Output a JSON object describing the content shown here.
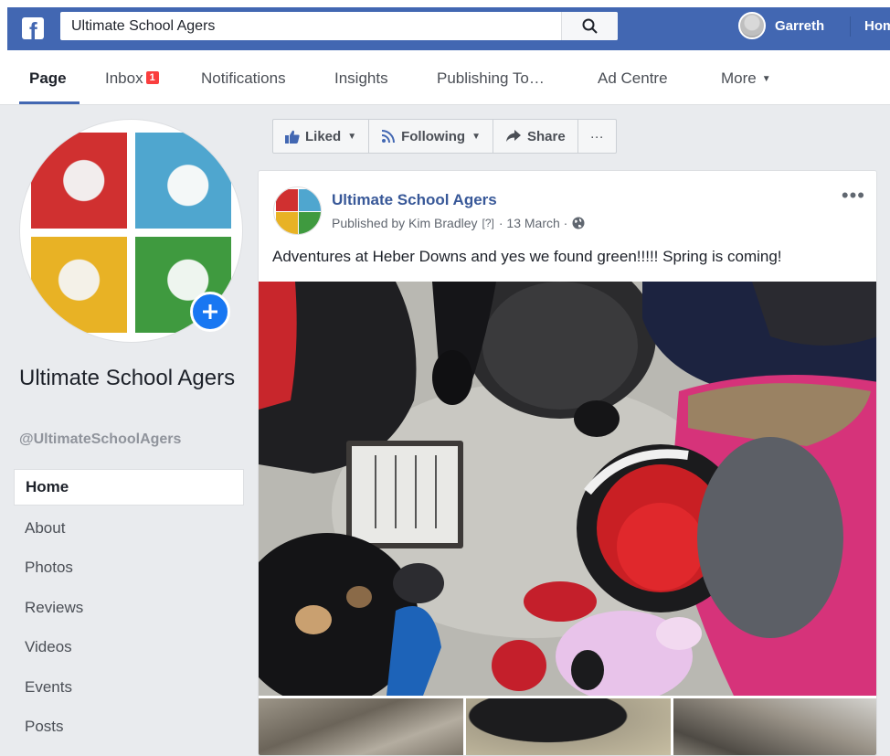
{
  "topbar": {
    "search_value": "Ultimate School Agers",
    "user_name": "Garreth",
    "home_label": "Hom"
  },
  "page_nav": {
    "tabs": [
      {
        "label": "Page"
      },
      {
        "label": "Inbox",
        "badge": "1"
      },
      {
        "label": "Notifications"
      },
      {
        "label": "Insights"
      },
      {
        "label": "Publishing To…"
      },
      {
        "label": "Ad Centre"
      },
      {
        "label": "More"
      }
    ]
  },
  "sidebar": {
    "page_name": "Ultimate School Agers",
    "handle": "@UltimateSchoolAgers",
    "items": [
      {
        "label": "Home"
      },
      {
        "label": "About"
      },
      {
        "label": "Photos"
      },
      {
        "label": "Reviews"
      },
      {
        "label": "Videos"
      },
      {
        "label": "Events"
      },
      {
        "label": "Posts"
      }
    ]
  },
  "action_bar": {
    "liked_label": "Liked",
    "following_label": "Following",
    "share_label": "Share",
    "more_label": "···"
  },
  "post": {
    "author": "Ultimate School Agers",
    "published_by": "Published by Kim Bradley",
    "help_marker": "[?]",
    "date": "· 13 March ·",
    "menu_label": "•••",
    "text": "Adventures at Heber Downs and yes we found green!!!!! Spring is coming!"
  },
  "colors": {
    "facebook_blue": "#4267b2",
    "link_blue": "#385898",
    "badge_red": "#fa3e3e",
    "add_button_blue": "#1877f2"
  },
  "icons": [
    "facebook-logo-icon",
    "search-icon",
    "like-thumb-icon",
    "rss-feed-icon",
    "share-arrow-icon",
    "globe-icon",
    "plus-icon"
  ]
}
